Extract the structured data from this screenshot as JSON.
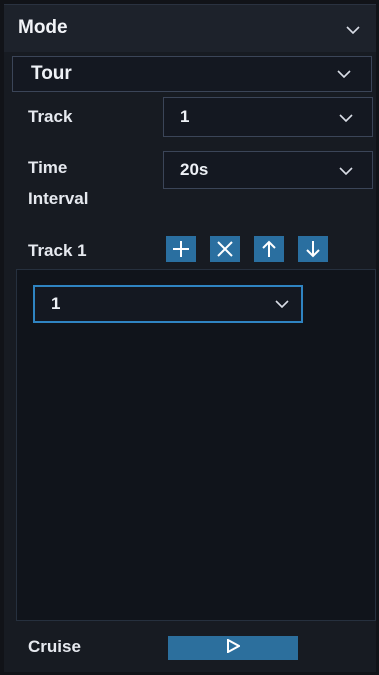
{
  "mode": {
    "title": "Mode"
  },
  "mode_select": {
    "value": "Tour"
  },
  "track": {
    "label": "Track",
    "value": "1"
  },
  "time_interval": {
    "label_line1": "Time",
    "label_line2": "Interval",
    "value": "20s"
  },
  "track_list": {
    "title": "Track 1",
    "tools": [
      "add-icon",
      "delete-icon",
      "move-up-icon",
      "move-down-icon"
    ],
    "items": [
      {
        "value": "1"
      }
    ]
  },
  "cruise": {
    "label": "Cruise",
    "button_icon": "play-icon"
  },
  "colors": {
    "accent": "#2f84c2",
    "button": "#2a6fa0",
    "background": "#171b22"
  }
}
